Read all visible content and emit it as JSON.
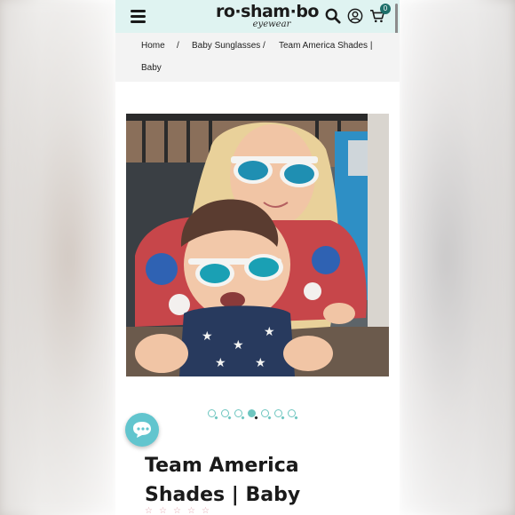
{
  "header": {
    "logo_main": "ro·sham·bo",
    "logo_sub": "eyewear",
    "cart_count": "0",
    "bg_color": "#dff3f1"
  },
  "breadcrumb": {
    "home": "Home",
    "separator": "/",
    "category": "Baby Sunglasses",
    "current_line1": "Team America Shades |",
    "current_line2": "Baby"
  },
  "product": {
    "title": "Team America Shades | Baby",
    "image_alt": "Two kids wearing white and blue mirrored sunglasses",
    "carousel": {
      "count": 7,
      "active_index": 3
    },
    "rating_stars": 5
  },
  "colors": {
    "accent": "#62c5ce",
    "dot": "#6ec6c0"
  },
  "icons": {
    "menu": "menu-icon",
    "search": "search-icon",
    "account": "user-icon",
    "cart": "cart-icon",
    "chat": "chat-icon"
  }
}
